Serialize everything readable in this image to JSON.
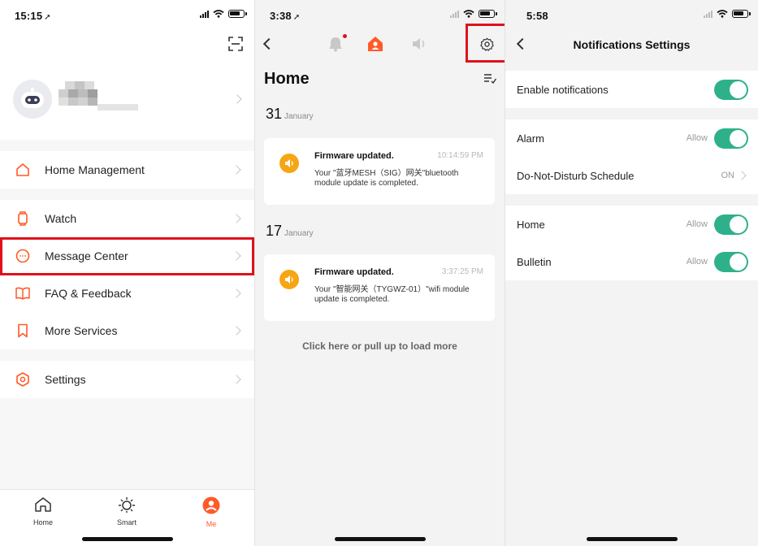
{
  "panel1": {
    "status_time": "15:15",
    "menu": [
      {
        "label": "Home Management"
      },
      {
        "label": "Watch"
      },
      {
        "label": "Message Center"
      },
      {
        "label": "FAQ & Feedback"
      },
      {
        "label": "More Services"
      },
      {
        "label": "Settings"
      }
    ],
    "tabs": [
      {
        "label": "Home"
      },
      {
        "label": "Smart"
      },
      {
        "label": "Me"
      }
    ]
  },
  "panel2": {
    "status_time": "3:38",
    "title": "Home",
    "days": [
      {
        "day": "31",
        "month": "January"
      },
      {
        "day": "17",
        "month": "January"
      }
    ],
    "messages": [
      {
        "title": "Firmware updated.",
        "time": "10:14:59 PM",
        "body": "Your \"蓝牙MESH（SIG）网关\"bluetooth module update is completed."
      },
      {
        "title": "Firmware updated.",
        "time": "3:37:25 PM",
        "body": "Your \"智能网关（TYGWZ-01）\"wifi module update is completed."
      }
    ],
    "load_more": "Click here or pull up to load more"
  },
  "panel3": {
    "status_time": "5:58",
    "title": "Notifications Settings",
    "rows": [
      {
        "label": "Enable notifications",
        "value": "",
        "on": true
      },
      {
        "label": "Alarm",
        "value": "Allow",
        "on": true
      },
      {
        "label": "Do-Not-Disturb Schedule",
        "value": "ON"
      },
      {
        "label": "Home",
        "value": "Allow",
        "on": true
      },
      {
        "label": "Bulletin",
        "value": "Allow",
        "on": true
      }
    ]
  },
  "colors": {
    "accent": "#ff5a28",
    "toggle_on": "#2eb18b",
    "highlight": "#e0111b",
    "message_icon": "#f6a614"
  }
}
